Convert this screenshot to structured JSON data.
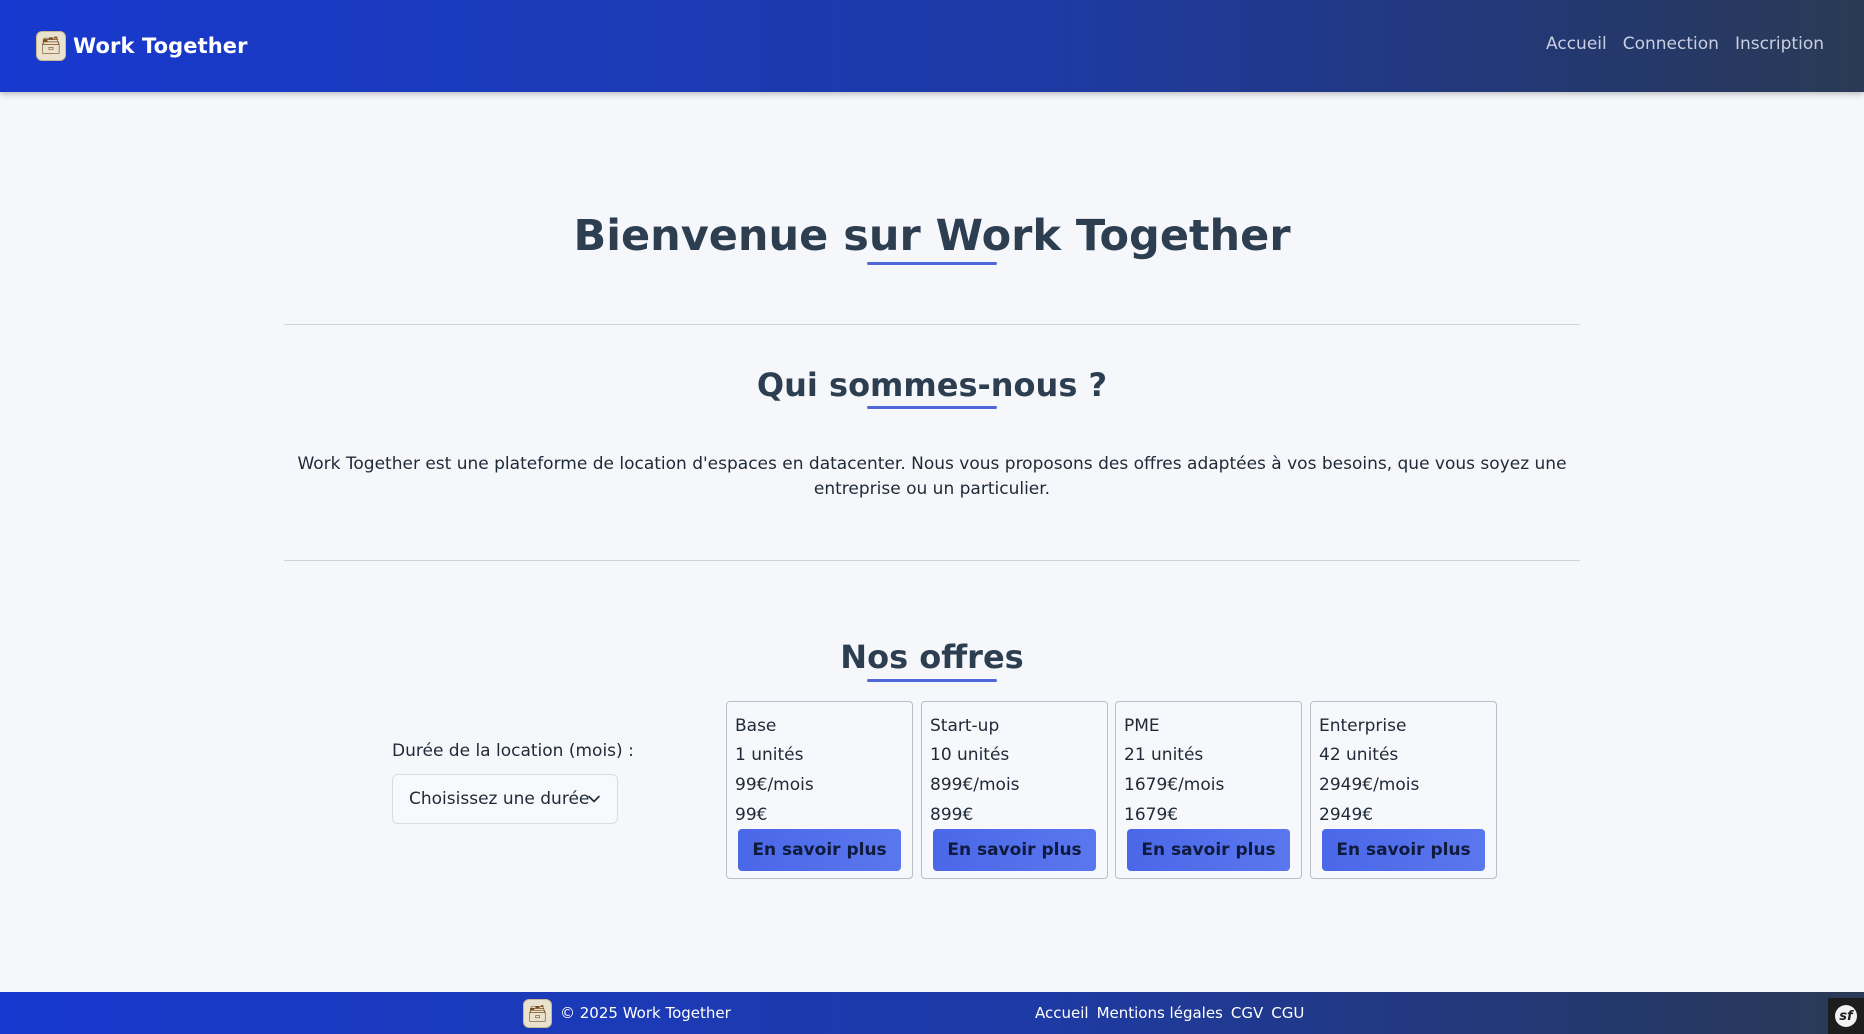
{
  "header": {
    "brand": "Work Together",
    "logo_icon": "🗃",
    "nav": [
      "Accueil",
      "Connection",
      "Inscription"
    ]
  },
  "hero": {
    "title": "Bienvenue sur Work Together"
  },
  "about": {
    "title": "Qui sommes-nous ?",
    "text": "Work Together est une plateforme de location d'espaces en datacenter. Nous vous proposons des offres adaptées à vos besoins, que vous soyez une entreprise ou un particulier."
  },
  "offers": {
    "title": "Nos offres",
    "duration_label": "Durée de la location (mois) :",
    "duration_select": "Choisissez une durée",
    "cards": [
      {
        "name": "Base",
        "units": "1 unités",
        "monthly": "99€/mois",
        "total": "99€",
        "button": "En savoir plus"
      },
      {
        "name": "Start-up",
        "units": "10 unités",
        "monthly": "899€/mois",
        "total": "899€",
        "button": "En savoir plus"
      },
      {
        "name": "PME",
        "units": "21 unités",
        "monthly": "1679€/mois",
        "total": "1679€",
        "button": "En savoir plus"
      },
      {
        "name": "Enterprise",
        "units": "42 unités",
        "monthly": "2949€/mois",
        "total": "2949€",
        "button": "En savoir plus"
      }
    ]
  },
  "footer": {
    "copyright": "© 2025 Work Together",
    "links": [
      "Accueil",
      "Mentions légales",
      "CGV",
      "CGU"
    ],
    "symfony_badge": "sf"
  },
  "colors": {
    "header_gradient_start": "#1739cf",
    "header_gradient_end": "#2a3a55",
    "accent": "#4f67d8",
    "button": "#4a67e8",
    "background": "#f5f7fb"
  }
}
